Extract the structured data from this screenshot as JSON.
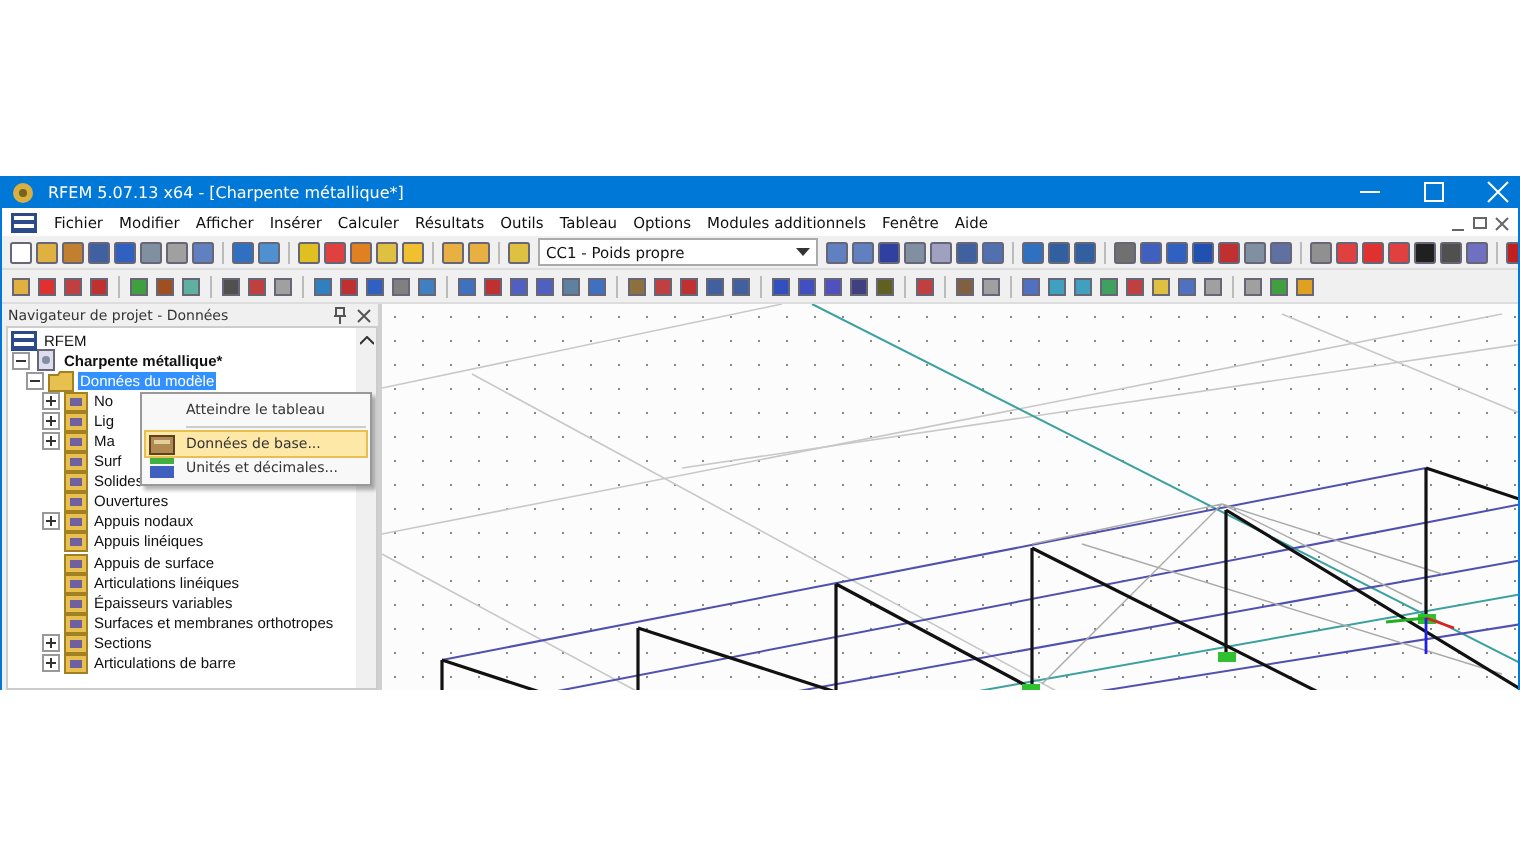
{
  "window": {
    "title": "RFEM 5.07.13 x64 - [Charpente métallique*]"
  },
  "menu": [
    "Fichier",
    "Modifier",
    "Afficher",
    "Insérer",
    "Calculer",
    "Résultats",
    "Outils",
    "Tableau",
    "Options",
    "Modules additionnels",
    "Fenêtre",
    "Aide"
  ],
  "load_case": {
    "value": "CC1 - Poids propre"
  },
  "navigator": {
    "title": "Navigateur de projet - Données",
    "tree": [
      {
        "label": "RFEM",
        "children": [
          {
            "label": "Charpente métallique*",
            "expanded": true,
            "children": [
              {
                "label": "Données du modèle",
                "expanded": true,
                "selected": true,
                "children": [
                  {
                    "label": "No",
                    "expanded": false,
                    "selected": false
                  },
                  {
                    "label": "Lig",
                    "expanded": false,
                    "selected": false
                  },
                  {
                    "label": "Ma",
                    "expanded": false,
                    "selected": false
                  },
                  {
                    "label": "Surf",
                    "selected": false
                  },
                  {
                    "label": "Solides",
                    "selected": false
                  },
                  {
                    "label": "Ouvertures",
                    "selected": false
                  },
                  {
                    "label": "Appuis nodaux",
                    "expanded": false,
                    "selected": false
                  },
                  {
                    "label": "Appuis linéiques",
                    "selected": false
                  },
                  {
                    "label": "Appuis de surface",
                    "selected": false
                  },
                  {
                    "label": "Articulations linéiques",
                    "selected": false
                  },
                  {
                    "label": "Épaisseurs variables",
                    "selected": false
                  },
                  {
                    "label": "Surfaces et membranes orthotropes",
                    "selected": false
                  },
                  {
                    "label": "Sections",
                    "expanded": false,
                    "selected": false
                  },
                  {
                    "label": "Articulations de barre",
                    "expanded": false,
                    "selected": false
                  }
                ]
              }
            ]
          }
        ]
      }
    ]
  },
  "context_menu": [
    {
      "label": "Atteindre le tableau",
      "kind": "plain",
      "selected": false
    },
    {
      "label": "Données de base...",
      "kind": "base",
      "selected": true
    },
    {
      "label": "Unités et décimales...",
      "kind": "units",
      "selected": false
    }
  ]
}
